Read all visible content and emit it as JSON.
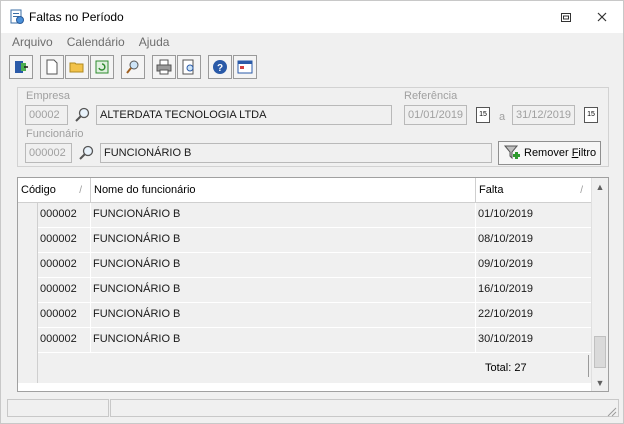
{
  "window": {
    "title": "Faltas no Período"
  },
  "menu": [
    "Arquivo",
    "Calendário",
    "Ajuda"
  ],
  "toolbar": {
    "buttons": [
      "exit-icon",
      "new-doc-icon",
      "open-folder-icon",
      "refresh-icon",
      "search-icon",
      "print-icon",
      "print-preview-icon",
      "help-icon",
      "window-icon"
    ]
  },
  "filters": {
    "empresa_label": "Empresa",
    "empresa_code": "00002",
    "empresa_name": "ALTERDATA TECNOLOGIA  LTDA",
    "referencia_label": "Referência",
    "date_from": "01/01/2019",
    "date_sep": "a",
    "date_to": "31/12/2019",
    "funcionario_label": "Funcionário",
    "funcionario_code": "000002",
    "funcionario_name": "FUNCIONÁRIO B",
    "remove_btn_pre": "Remover ",
    "remove_btn_u": "F",
    "remove_btn_post": "iltro"
  },
  "grid": {
    "columns": [
      "Código",
      "Nome do funcionário",
      "Falta"
    ],
    "rows": [
      [
        "000002",
        "FUNCIONÁRIO B",
        "01/10/2019"
      ],
      [
        "000002",
        "FUNCIONÁRIO B",
        "08/10/2019"
      ],
      [
        "000002",
        "FUNCIONÁRIO B",
        "09/10/2019"
      ],
      [
        "000002",
        "FUNCIONÁRIO B",
        "16/10/2019"
      ],
      [
        "000002",
        "FUNCIONÁRIO B",
        "22/10/2019"
      ],
      [
        "000002",
        "FUNCIONÁRIO B",
        "30/10/2019"
      ]
    ],
    "total": "Total: 27"
  }
}
